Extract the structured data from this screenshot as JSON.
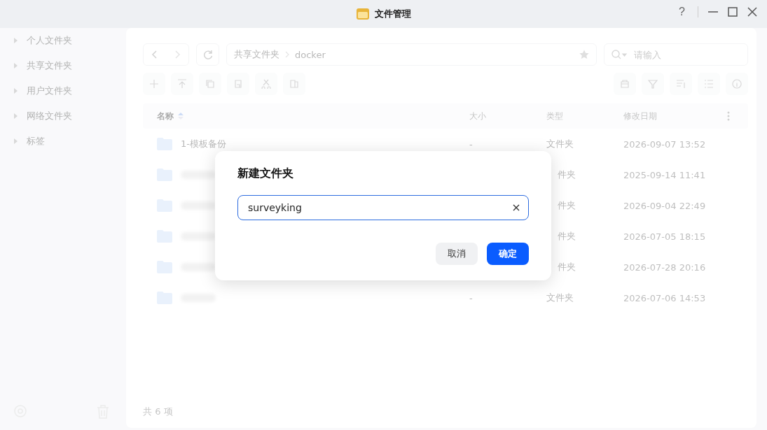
{
  "window": {
    "title": "文件管理",
    "buttons": [
      "?"
    ]
  },
  "sidebar": {
    "items": [
      {
        "label": "个人文件夹",
        "expanded": false
      },
      {
        "label": "共享文件夹",
        "expanded": false
      },
      {
        "label": "用户文件夹",
        "expanded": false
      },
      {
        "label": "网络文件夹",
        "expanded": false
      },
      {
        "label": "标签",
        "expanded": false
      }
    ]
  },
  "path": {
    "segments": [
      "共享文件夹",
      "docker"
    ]
  },
  "search": {
    "placeholder": "请输入"
  },
  "table": {
    "columns": [
      {
        "label": "名称",
        "sorted": true
      },
      {
        "label": "大小",
        "sorted": false
      },
      {
        "label": "类型",
        "sorted": false
      },
      {
        "label": "修改日期",
        "sorted": false
      }
    ],
    "rows": [
      {
        "kind": "named",
        "name": "1-模板备份",
        "size": "-",
        "type": "文件夹",
        "modified": "2026-09-07 13:52"
      },
      {
        "kind": "blurred",
        "type": "件夹",
        "covered": true,
        "modified": "2025-09-14 11:41"
      },
      {
        "kind": "blurred",
        "type": "件夹",
        "covered": true,
        "modified": "2026-09-04 22:49"
      },
      {
        "kind": "blurred",
        "type": "件夹",
        "covered": true,
        "modified": "2026-07-05 18:15"
      },
      {
        "kind": "blurred",
        "type": "件夹",
        "covered": true,
        "modified": "2026-07-28 20:16"
      },
      {
        "kind": "blurred",
        "size": "-",
        "type": "文件夹",
        "modified": "2026-07-06 14:53"
      }
    ]
  },
  "status_bar": {
    "text": "共 6 项"
  },
  "dialog": {
    "title": "新建文件夹",
    "value": "surveyking",
    "buttons": [
      {
        "label": "取消",
        "kind": "secondary"
      },
      {
        "label": "确定",
        "kind": "primary"
      }
    ]
  }
}
